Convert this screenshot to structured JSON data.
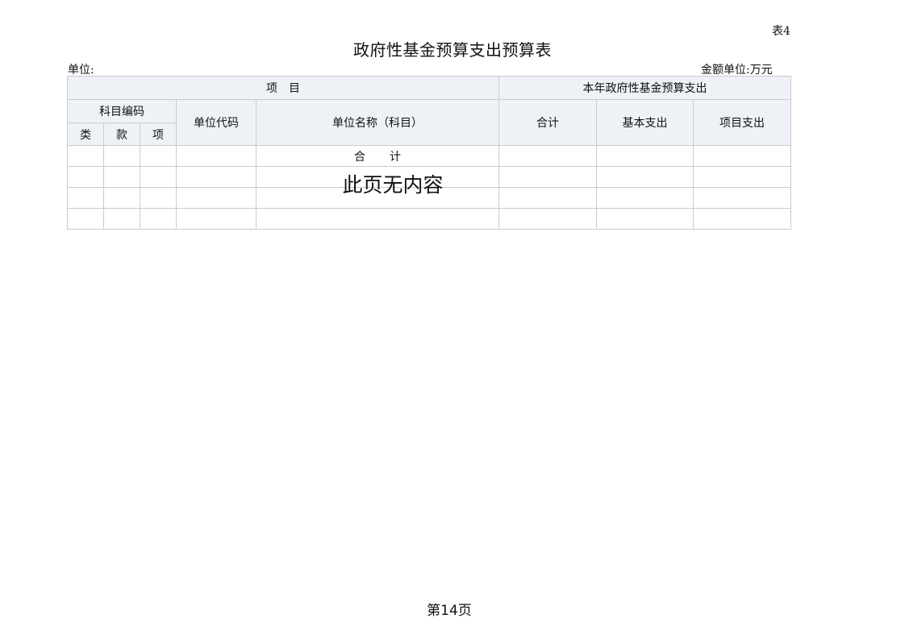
{
  "header": {
    "table_number": "表4",
    "title": "政府性基金预算支出预算表",
    "unit_label": "单位:",
    "amount_unit": "金额单位:万元"
  },
  "table": {
    "group_item": "项　目",
    "group_budget": "本年政府性基金预算支出",
    "subject_code": "科目编码",
    "unit_code": "单位代码",
    "unit_name": "单位名称（科目）",
    "total": "合计",
    "basic_expense": "基本支出",
    "project_expense": "项目支出",
    "code_class": "类",
    "code_section": "款",
    "code_item": "项",
    "total_row_label": "合计"
  },
  "notice": "此页无内容",
  "footer": {
    "page_number": "第14页"
  }
}
